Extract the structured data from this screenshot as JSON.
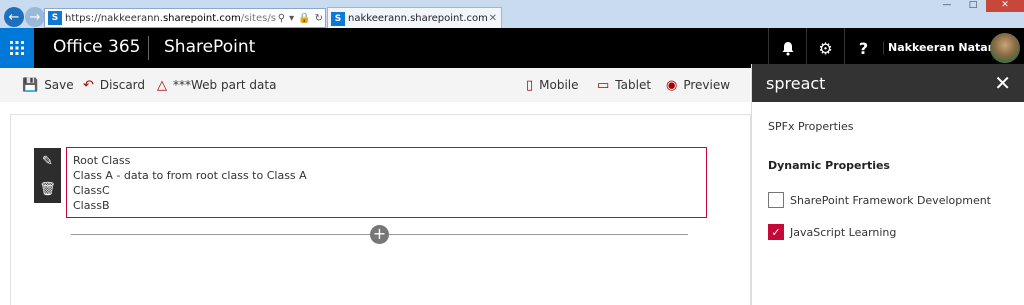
{
  "browser": {
    "url_prefix": "https://nakkeerann.",
    "url_host": "sharepoint.com",
    "url_path": "/sites/spfx/Sha",
    "tab_label": "nakkeerann.sharepoint.com",
    "sp_favicon": "S"
  },
  "suite": {
    "brand": "Office 365",
    "app": "SharePoint",
    "user": "Nakkeeran Natar...",
    "buttons": [
      "bell-icon",
      "gear-icon",
      "help-icon"
    ]
  },
  "command_bar": {
    "save": "Save",
    "discard": "Discard",
    "webpart_data": "***Web part data",
    "mobile": "Mobile",
    "tablet": "Tablet",
    "preview": "Preview"
  },
  "webpart": {
    "lines": [
      "Root Class",
      "Class A - data to from root class to Class A",
      "ClassC",
      "ClassB"
    ]
  },
  "pane": {
    "title": "spreact",
    "spfx": "SPFx Properties",
    "dynamic": "Dynamic Properties",
    "options": [
      {
        "label": "SharePoint Framework Development",
        "checked": false
      },
      {
        "label": "JavaScript Learning",
        "checked": true
      }
    ]
  },
  "colors": {
    "accent": "#c4083a",
    "suite_bg": "#000000",
    "waffle": "#0078d7"
  }
}
